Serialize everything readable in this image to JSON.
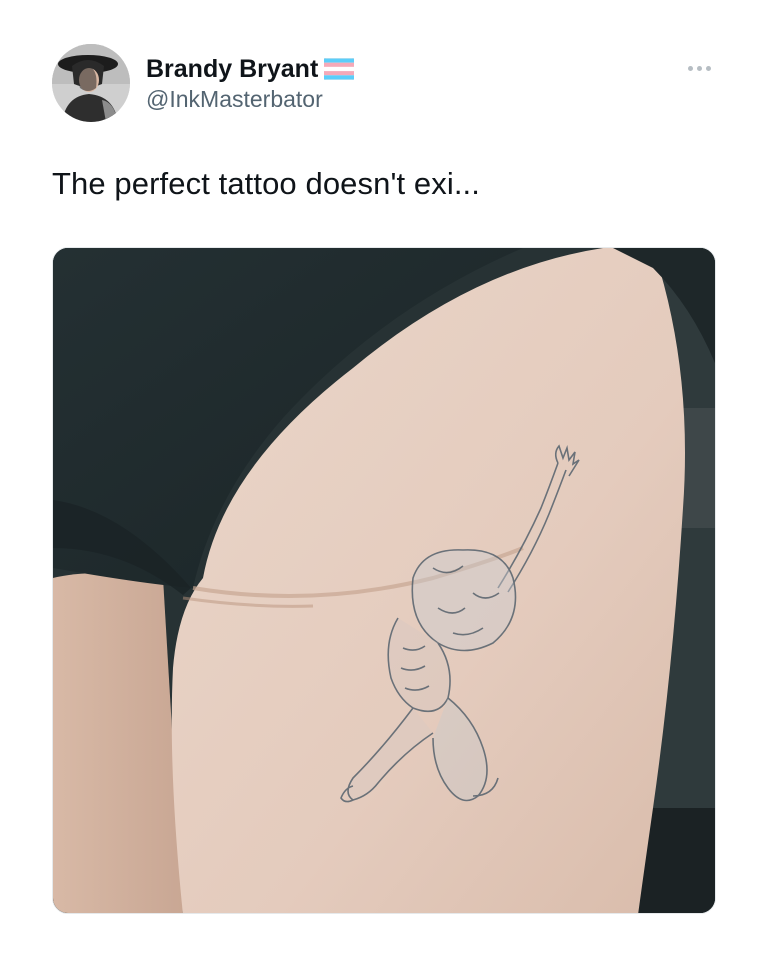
{
  "tweet": {
    "author": {
      "display_name": "Brandy Bryant",
      "handle": "@InkMasterbator",
      "badge_icon": "transgender-flag-icon",
      "avatar_icon": "avatar-photo"
    },
    "more_icon": "more-options-icon",
    "text": "The perfect tattoo doesn't exi...",
    "media": {
      "type": "photo",
      "subject_icon": "tattoo-photo"
    }
  },
  "colors": {
    "text_primary": "#0f1419",
    "text_secondary": "#536471",
    "flag_blue": "#5bcefa",
    "flag_pink": "#f5a9b8",
    "flag_white": "#ffffff"
  }
}
